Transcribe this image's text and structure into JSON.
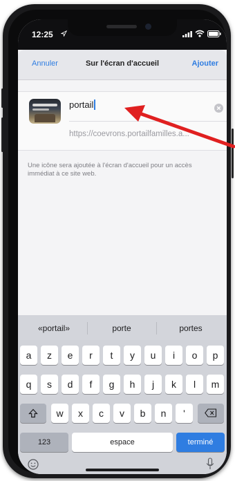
{
  "status_bar": {
    "time": "12:25"
  },
  "nav": {
    "cancel_label": "Annuler",
    "title": "Sur l'écran d'accueil",
    "add_label": "Ajouter"
  },
  "form": {
    "name_value": "portail",
    "url": "https://coevrons.portailfamilles.a..."
  },
  "info_text": "Une icône sera ajoutée à l'écran d'accueil pour un accès immédiat à ce site web.",
  "keyboard": {
    "suggestions": [
      "«portail»",
      "porte",
      "portes"
    ],
    "row1": [
      "a",
      "z",
      "e",
      "r",
      "t",
      "y",
      "u",
      "i",
      "o",
      "p"
    ],
    "row2": [
      "q",
      "s",
      "d",
      "f",
      "g",
      "h",
      "j",
      "k",
      "l",
      "m"
    ],
    "row3": [
      "w",
      "x",
      "c",
      "v",
      "b",
      "n",
      "'"
    ],
    "numbers_label": "123",
    "space_label": "espace",
    "done_label": "terminé"
  },
  "colors": {
    "accent": "#2f7de1",
    "annotation_arrow": "#e02020"
  }
}
